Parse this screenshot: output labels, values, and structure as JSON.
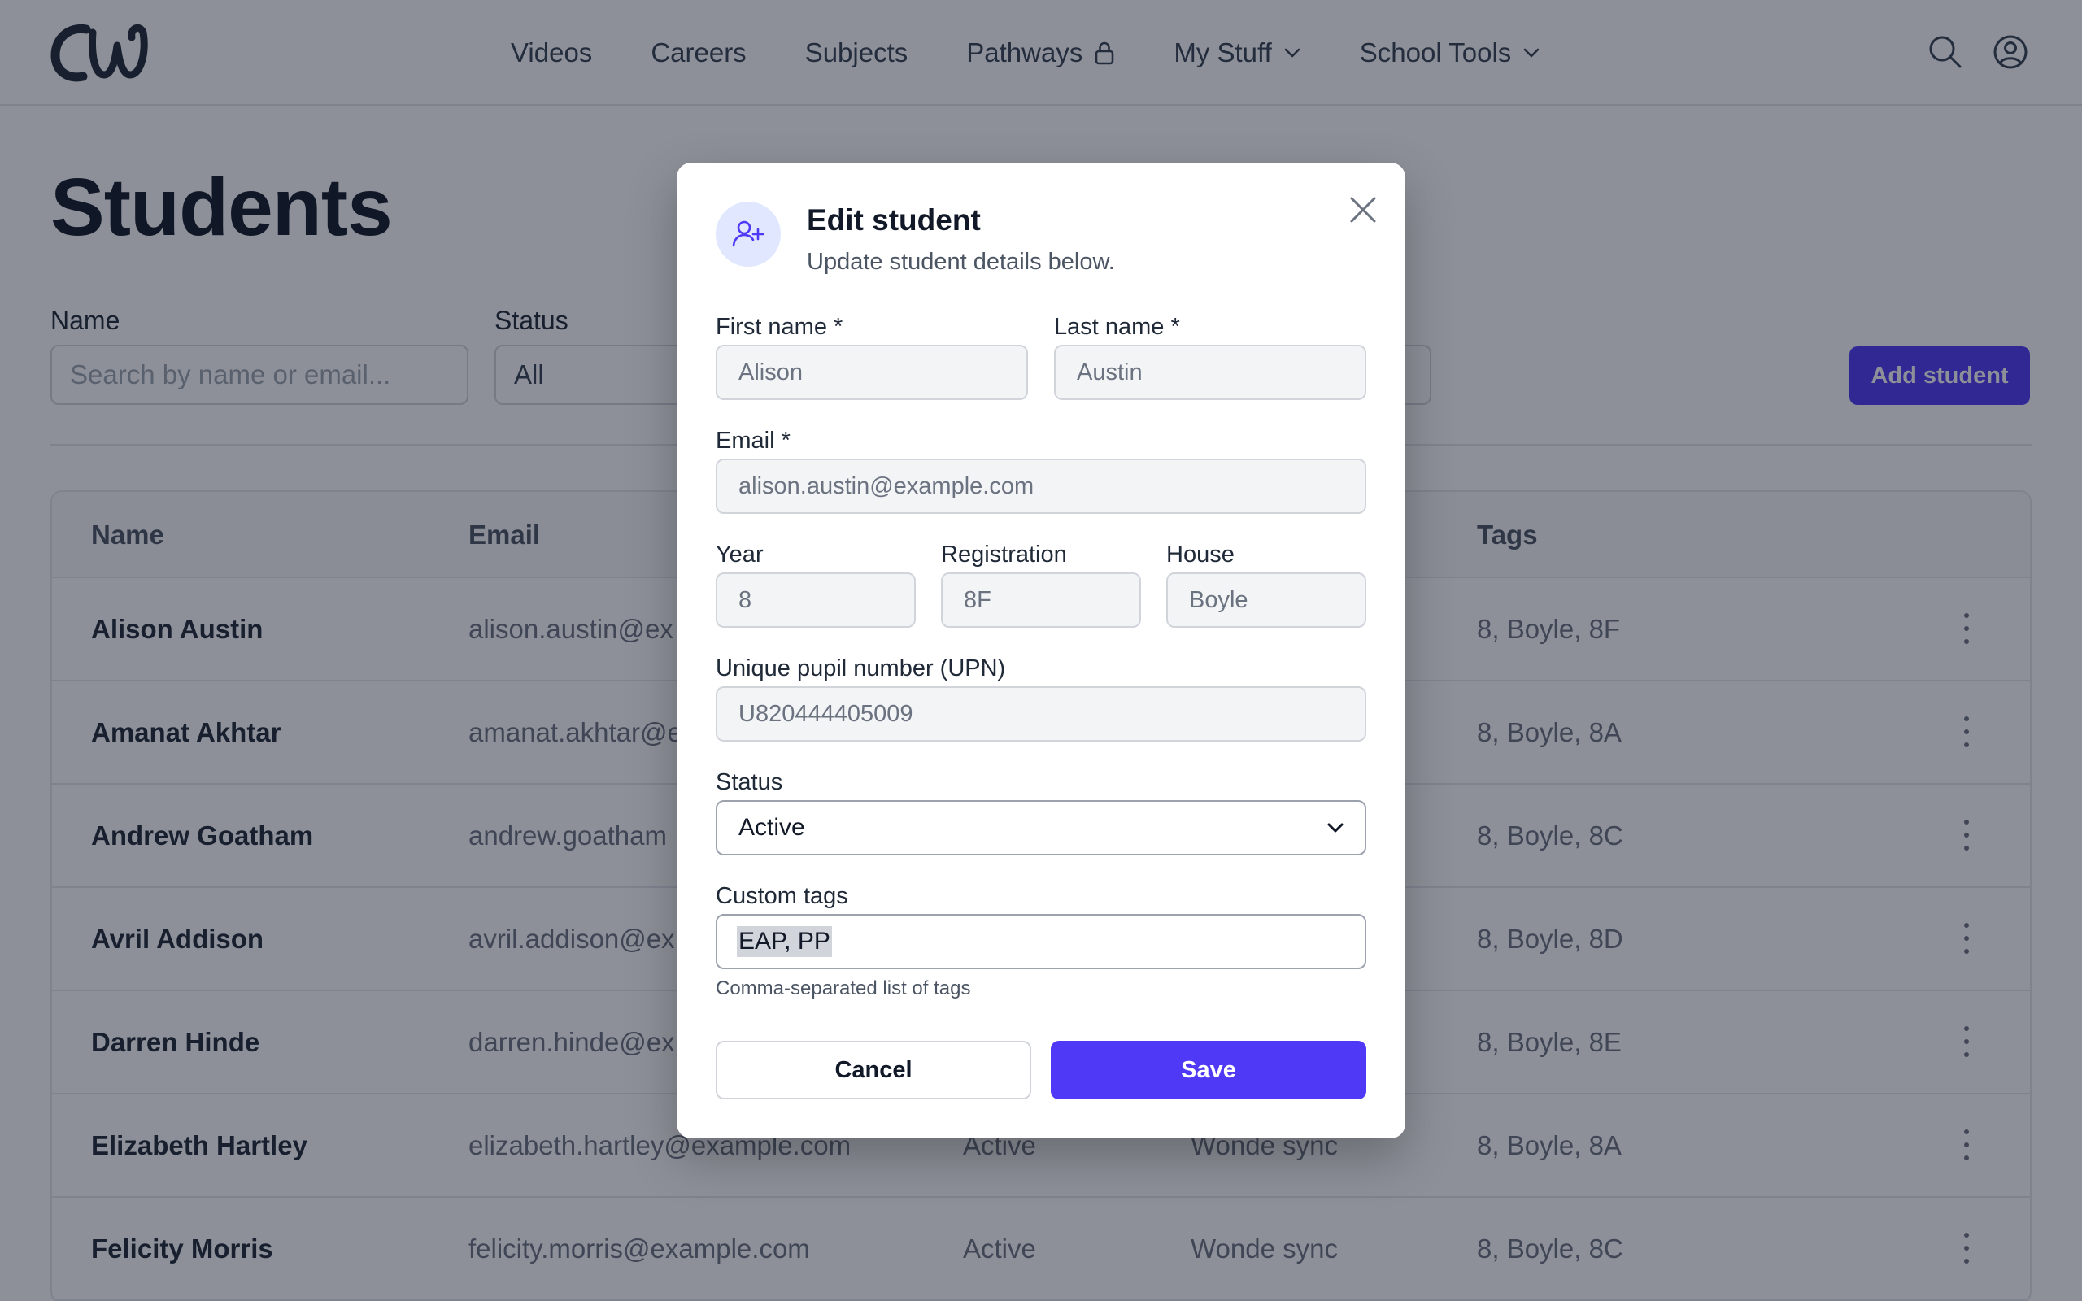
{
  "colors": {
    "accent": "#4f39f6",
    "overlay": "rgba(17,24,39,0.48)",
    "nav_text": "#374151"
  },
  "nav": {
    "logo_text": "CW",
    "items": [
      {
        "label": "Videos",
        "icon": ""
      },
      {
        "label": "Careers",
        "icon": ""
      },
      {
        "label": "Subjects",
        "icon": ""
      },
      {
        "label": "Pathways",
        "icon": "lock-icon"
      },
      {
        "label": "My Stuff",
        "icon": "chevron-down-icon"
      },
      {
        "label": "School Tools",
        "icon": "chevron-down-icon"
      }
    ],
    "right_icons": [
      "search-icon",
      "user-circle-icon"
    ]
  },
  "page": {
    "title": "Students",
    "filters": {
      "name_label": "Name",
      "name_placeholder": "Search by name or email...",
      "status_label": "Status",
      "status_value": "All"
    },
    "add_button": "Add student"
  },
  "table": {
    "headers": [
      "Name",
      "Email",
      "Tags"
    ],
    "rows": [
      {
        "name": "Alison Austin",
        "email": "alison.austin@ex",
        "status": "",
        "source": "",
        "tags": "8, Boyle, 8F"
      },
      {
        "name": "Amanat Akhtar",
        "email": "amanat.akhtar@e",
        "status": "",
        "source": "",
        "tags": "8, Boyle, 8A"
      },
      {
        "name": "Andrew Goatham",
        "email": "andrew.goatham",
        "status": "",
        "source": "",
        "tags": "8, Boyle, 8C"
      },
      {
        "name": "Avril Addison",
        "email": "avril.addison@ex",
        "status": "",
        "source": "",
        "tags": "8, Boyle, 8D"
      },
      {
        "name": "Darren Hinde",
        "email": "darren.hinde@ex",
        "status": "",
        "source": "",
        "tags": "8, Boyle, 8E"
      },
      {
        "name": "Elizabeth Hartley",
        "email": "elizabeth.hartley@example.com",
        "status": "Active",
        "source": "Wonde sync",
        "tags": "8, Boyle, 8A"
      },
      {
        "name": "Felicity Morris",
        "email": "felicity.morris@example.com",
        "status": "Active",
        "source": "Wonde sync",
        "tags": "8, Boyle, 8C"
      }
    ]
  },
  "modal": {
    "title": "Edit student",
    "subtitle": "Update student details below.",
    "avatar_icon": "user-plus-icon",
    "first_name": {
      "label": "First name *",
      "value": "Alison"
    },
    "last_name": {
      "label": "Last name *",
      "value": "Austin"
    },
    "email": {
      "label": "Email *",
      "value": "alison.austin@example.com"
    },
    "year": {
      "label": "Year",
      "value": "8"
    },
    "registration": {
      "label": "Registration",
      "value": "8F"
    },
    "house": {
      "label": "House",
      "value": "Boyle"
    },
    "upn": {
      "label": "Unique pupil number (UPN)",
      "value": "U820444405009"
    },
    "status": {
      "label": "Status",
      "value": "Active"
    },
    "custom_tags": {
      "label": "Custom tags",
      "value": "EAP, PP",
      "help": "Comma-separated list of tags"
    },
    "cancel_label": "Cancel",
    "save_label": "Save"
  }
}
